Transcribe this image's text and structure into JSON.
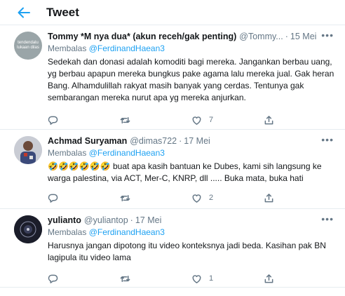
{
  "header": {
    "title": "Tweet"
  },
  "tweets": [
    {
      "name": "Tommy *M nya dua* (akun receh/gak penting)",
      "handle": "@Tommy...",
      "sep": "·",
      "time": "15 Mei",
      "replying_prefix": "Membalas",
      "replying_to": "@FerdinandHaean3",
      "avatar_text": "tendendalu lukaan dilas",
      "text": "Sedekah dan donasi adalah komoditi bagi mereka. Jangankan berbau uang, yg berbau apapun mereka bungkus pake agama lalu mereka jual. Gak heran Bang. Alhamdulillah rakyat masih banyak yang cerdas. Tentunya gak sembarangan mereka nurut apa yg mereka anjurkan.",
      "replies": "",
      "retweets": "",
      "likes": "7",
      "avatar_color": "#9aa5a8"
    },
    {
      "name": "Achmad Suryaman",
      "handle": "@dimas722",
      "sep": "·",
      "time": "17 Mei",
      "replying_prefix": "Membalas",
      "replying_to": "@FerdinandHaean3",
      "emojis": "🤣🤣🤣🤣🤣🤣",
      "text": "buat apa kasih bantuan ke Dubes, kami sih langsung ke warga palestina, via ACT, Mer-C, KNRP, dll ..... Buka mata, buka hati",
      "replies": "",
      "retweets": "",
      "likes": "2",
      "avatar_color": "#3b4a7a"
    },
    {
      "name": "yulianto",
      "handle": "@yuliantop",
      "sep": "·",
      "time": "17 Mei",
      "replying_prefix": "Membalas",
      "replying_to": "@FerdinandHaean3",
      "text": "Harusnya jangan dipotong itu video konteksnya jadi beda. Kasihan pak BN lagipula itu video lama",
      "replies": "",
      "retweets": "",
      "likes": "1",
      "avatar_color": "#1b1d2a"
    }
  ],
  "more_label": "•••",
  "accent": "#1da1f2"
}
